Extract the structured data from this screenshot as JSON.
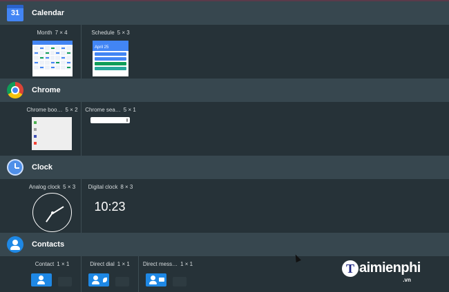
{
  "sections": [
    {
      "title": "Calendar",
      "icon": "calendar-icon",
      "icon_text": "31",
      "widgets": [
        {
          "name": "Month",
          "size": "7 × 4"
        },
        {
          "name": "Schedule",
          "size": "5 × 3"
        }
      ]
    },
    {
      "title": "Chrome",
      "icon": "chrome-icon",
      "widgets": [
        {
          "name": "Chrome boo…",
          "size": "5 × 2"
        },
        {
          "name": "Chrome sea…",
          "size": "5 × 1"
        }
      ]
    },
    {
      "title": "Clock",
      "icon": "clock-icon",
      "widgets": [
        {
          "name": "Analog clock",
          "size": "5 × 3"
        },
        {
          "name": "Digital clock",
          "size": "8 × 3"
        }
      ]
    },
    {
      "title": "Contacts",
      "icon": "person-icon",
      "widgets": [
        {
          "name": "Contact",
          "size": "1 × 1"
        },
        {
          "name": "Direct dial",
          "size": "1 × 1"
        },
        {
          "name": "Direct mess…",
          "size": "1 × 1"
        }
      ]
    }
  ],
  "previews": {
    "schedule_date": "April 25",
    "digital_time": "10:23"
  },
  "watermark": {
    "logo_letter": "T",
    "text": "aimienphi",
    "suffix": ".vn"
  },
  "colors": {
    "background": "#263238",
    "header": "#37474f",
    "accent": "#4285f4",
    "contacts_blue": "#1e88e5"
  }
}
